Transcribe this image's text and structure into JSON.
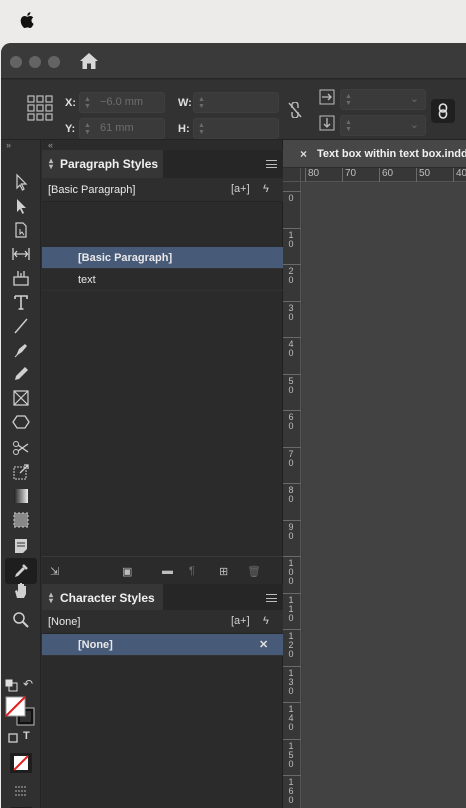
{
  "control_bar": {
    "x_label": "X:",
    "y_label": "Y:",
    "w_label": "W:",
    "h_label": "H:",
    "x_value": "−6.0 mm",
    "y_value": "61 mm",
    "w_value": "",
    "h_value": ""
  },
  "paragraph_styles": {
    "title": "Paragraph Styles",
    "current": "[Basic Paragraph]",
    "items": [
      "[Basic Paragraph]",
      "text"
    ]
  },
  "character_styles": {
    "title": "Character Styles",
    "current": "[None]",
    "items": [
      "[None]"
    ]
  },
  "document": {
    "tab_title": "Text box within text box.indd"
  },
  "rulers": {
    "horizontal": [
      "80",
      "70",
      "60",
      "50",
      "40"
    ],
    "vertical": [
      "0",
      "10",
      "20",
      "30",
      "40",
      "50",
      "60",
      "70",
      "80",
      "90",
      "100",
      "110",
      "120",
      "130",
      "140",
      "150",
      "160"
    ]
  },
  "icons": {
    "apple": "apple-icon",
    "home": "home-icon",
    "selection": "selection-tool-icon",
    "type": "type-tool-icon",
    "eyedropper": "eyedropper-tool-icon"
  },
  "colors": {
    "selected_row": "#475a78",
    "panel_bg": "#2b2b2b",
    "tab_active": "#363636"
  }
}
